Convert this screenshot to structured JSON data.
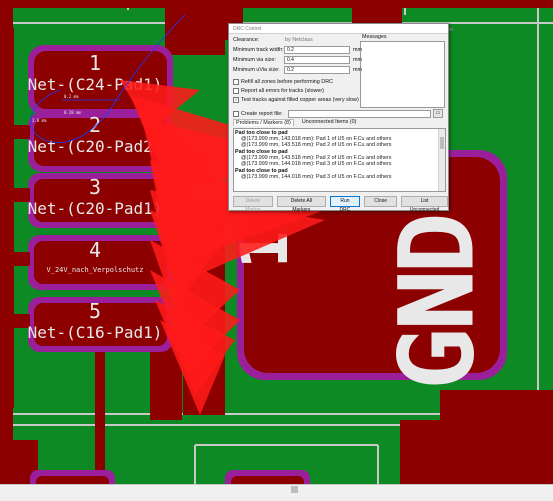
{
  "board": {
    "pads": [
      {
        "number": "1",
        "net": "Net-(C24-Pad1)"
      },
      {
        "number": "2",
        "net": "Net-(C20-Pad2)"
      },
      {
        "number": "3",
        "net": "Net-(C20-Pad1)"
      },
      {
        "number": "4",
        "net": "V_24V_nach_Verpolschutz"
      },
      {
        "number": "5",
        "net": "Net-(C16-Pad1)"
      }
    ],
    "gnd_label": "GND",
    "gnd_number": "1"
  },
  "dialog": {
    "title": "DRC Control",
    "window_buttons": [
      "—",
      "☐",
      "✕"
    ],
    "clearance_label": "Clearance:",
    "clearance_value": "by Netclass",
    "messages_label": "Messages",
    "fields": [
      {
        "label": "Minimum track width:",
        "value": "0.2",
        "unit": "mm"
      },
      {
        "label": "Minimum via size:",
        "value": "0.4",
        "unit": "mm"
      },
      {
        "label": "Minimum uVia size:",
        "value": "0.2",
        "unit": "mm"
      }
    ],
    "options": [
      {
        "label": "Refill all zones before performing DRC",
        "checked": false
      },
      {
        "label": "Report all errors for tracks (slower)",
        "checked": false
      },
      {
        "label": "Test tracks against filled copper areas (very slow)",
        "checked": true
      }
    ],
    "report_label": "Create report file:",
    "tabs": [
      "Problems / Markers (8)",
      "Unconnected Items (0)"
    ],
    "problems": [
      {
        "title": "Pad too close to pad",
        "items": [
          "@(173.999 mm, 143.018 mm): Pad 1 of U5 on F.Cu and others",
          "@(173.999 mm, 143.518 mm): Pad 2 of U5 on F.Cu and others"
        ]
      },
      {
        "title": "Pad too close to pad",
        "items": [
          "@(173.999 mm, 143.518 mm): Pad 2 of U5 on F.Cu and others",
          "@(173.999 mm, 144.018 mm): Pad 3 of U5 on F.Cu and others"
        ]
      },
      {
        "title": "Pad too close to pad",
        "items": [
          "@(173.999 mm, 144.018 mm): Pad 3 of U5 on F.Cu and others"
        ]
      }
    ],
    "buttons": {
      "delete_marker": "Delete Marker",
      "delete_all": "Delete All Markers",
      "run": "Run DRC",
      "close": "Close",
      "list_unconnected": "List Unconnected"
    }
  },
  "colors": {
    "board_green": "#0d8a24",
    "copper_dark_red": "#8c0000",
    "marker_red": "#ff1a1a",
    "pad_outline_purple": "#9b1f9b",
    "silkscreen": "#e8e8e8"
  }
}
